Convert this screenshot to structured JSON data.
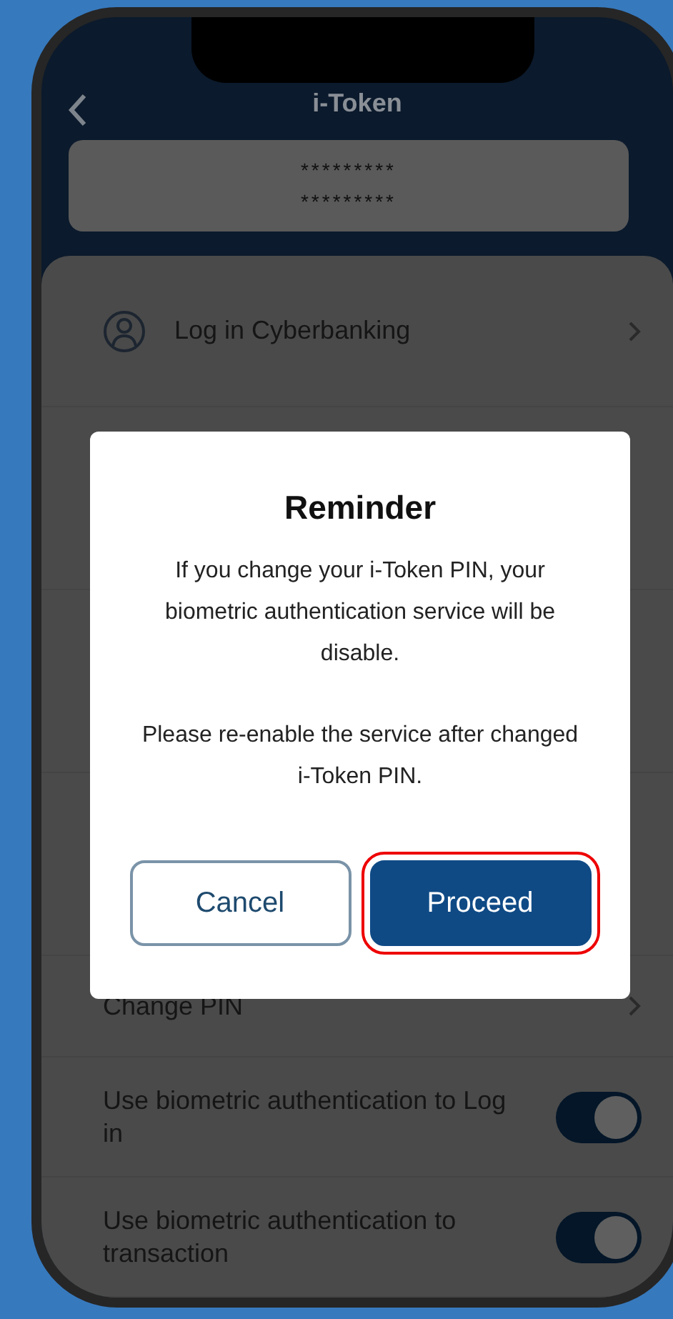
{
  "header": {
    "title": "i-Token"
  },
  "token_card": {
    "lines": [
      "*********",
      "*********"
    ]
  },
  "menu": [
    {
      "kind": "account_link",
      "label": "Log in Cyberbanking"
    },
    {
      "kind": "hidden"
    },
    {
      "kind": "hidden"
    },
    {
      "kind": "hidden"
    },
    {
      "kind": "link",
      "label": "Change PIN"
    },
    {
      "kind": "toggle",
      "label": "Use biometric authentication to Log in",
      "on": true
    },
    {
      "kind": "toggle",
      "label": "Use biometric authentication to transaction",
      "on": true
    }
  ],
  "dialog": {
    "title": "Reminder",
    "paragraphs": [
      "If you change your i-Token PIN, your biometric authentication service will be disable.",
      "Please re-enable the service after changed i-Token PIN."
    ],
    "buttons": [
      {
        "label": "Cancel",
        "kind": "secondary",
        "highlighted": false
      },
      {
        "label": "Proceed",
        "kind": "primary",
        "highlighted": true
      }
    ]
  }
}
